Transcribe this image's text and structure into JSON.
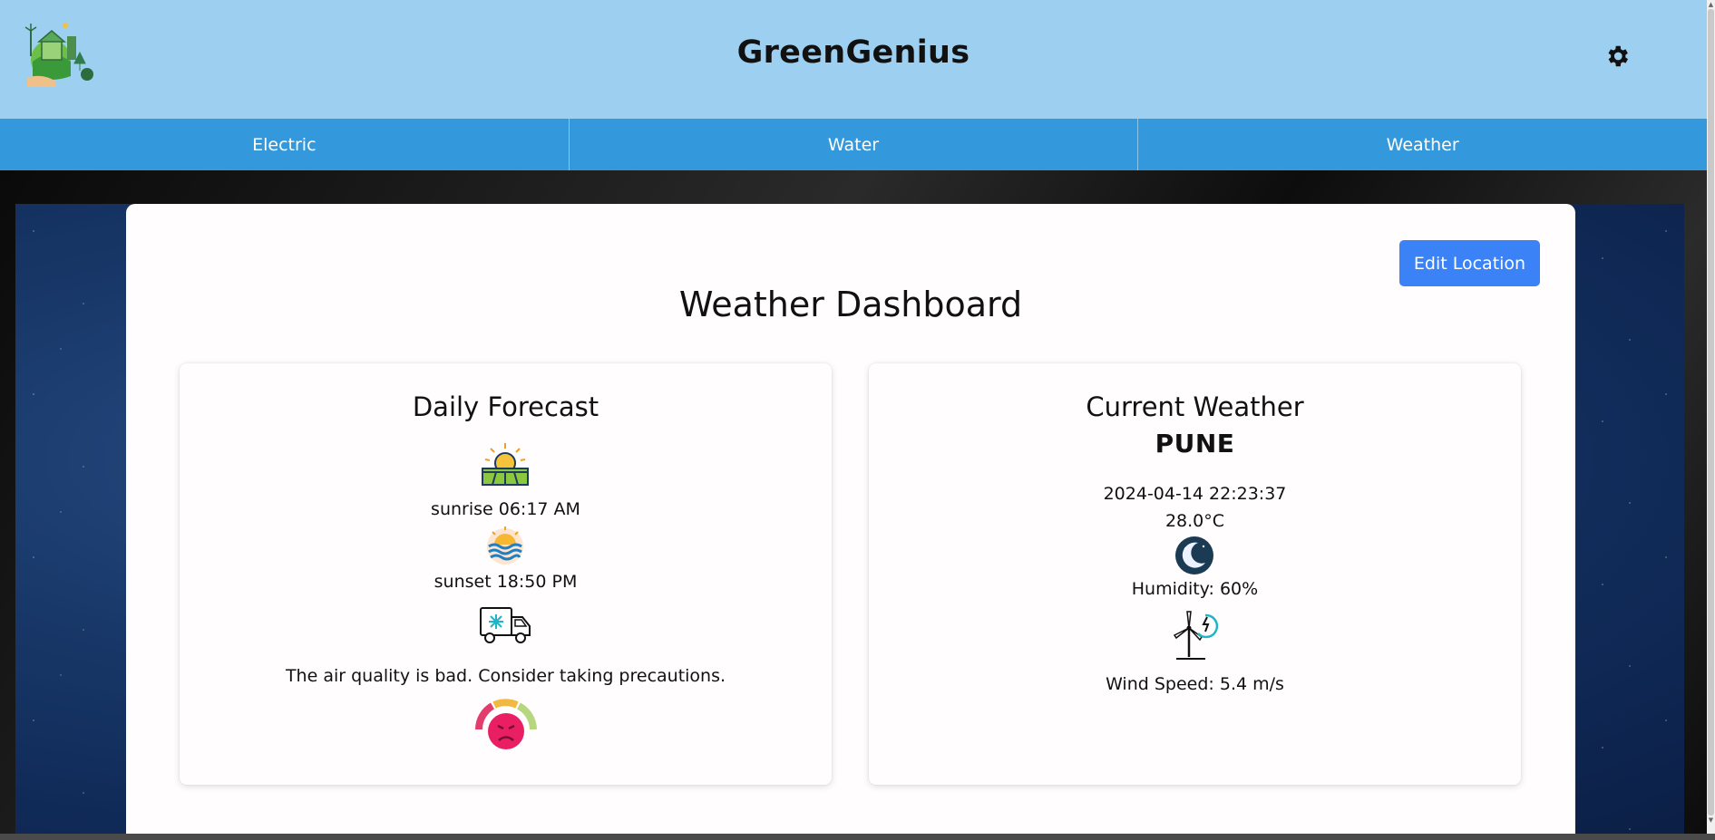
{
  "app": {
    "title": "GreenGenius",
    "logo_icon": "eco-house-logo-icon",
    "settings_icon": "gear-icon"
  },
  "nav": {
    "tabs": [
      {
        "label": "Electric"
      },
      {
        "label": "Water"
      },
      {
        "label": "Weather"
      }
    ]
  },
  "page": {
    "title": "Weather Dashboard",
    "edit_location_label": "Edit Location"
  },
  "daily_forecast": {
    "title": "Daily Forecast",
    "sunrise_icon": "sunrise-icon",
    "sunrise_text": "sunrise 06:17 AM",
    "sunset_icon": "sunset-icon",
    "sunset_text": "sunset 18:50 PM",
    "air_quality_icon": "truck-icon",
    "air_quality_text": "The air quality is bad. Consider taking precautions.",
    "air_quality_gauge_icon": "sad-face-gauge-icon"
  },
  "current_weather": {
    "title": "Current Weather",
    "city": "PUNE",
    "datetime": "2024-04-14 22:23:37",
    "temperature": "28.0°C",
    "condition_icon": "moon-night-icon",
    "humidity_text": "Humidity: 60%",
    "wind_icon": "wind-turbine-icon",
    "wind_text": "Wind Speed: 5.4 m/s"
  },
  "colors": {
    "header_bg": "#9dcff0",
    "nav_bg": "#3499dc",
    "button_bg": "#3b82f6",
    "panel_bg": "#fffdfd"
  }
}
